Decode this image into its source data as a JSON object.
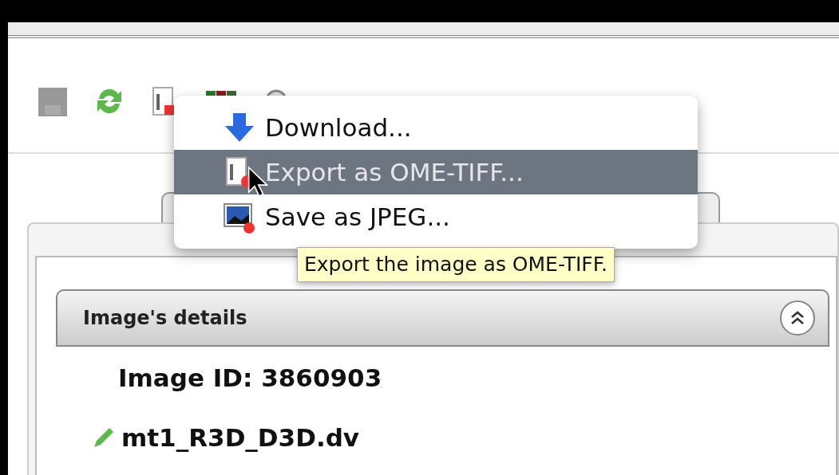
{
  "menu": {
    "items": [
      {
        "kind": "download",
        "label": "Download...",
        "selected": false
      },
      {
        "kind": "export",
        "label": "Export as OME-TIFF...",
        "selected": true
      },
      {
        "kind": "jpeg",
        "label": "Save as JPEG...",
        "selected": false
      }
    ]
  },
  "tooltip": "Export the image as OME-TIFF.",
  "panel": {
    "title": "Image's details",
    "expanded": true,
    "image_id": "Image ID: 3860903",
    "image_name": "mt1_R3D_D3D.dv"
  }
}
